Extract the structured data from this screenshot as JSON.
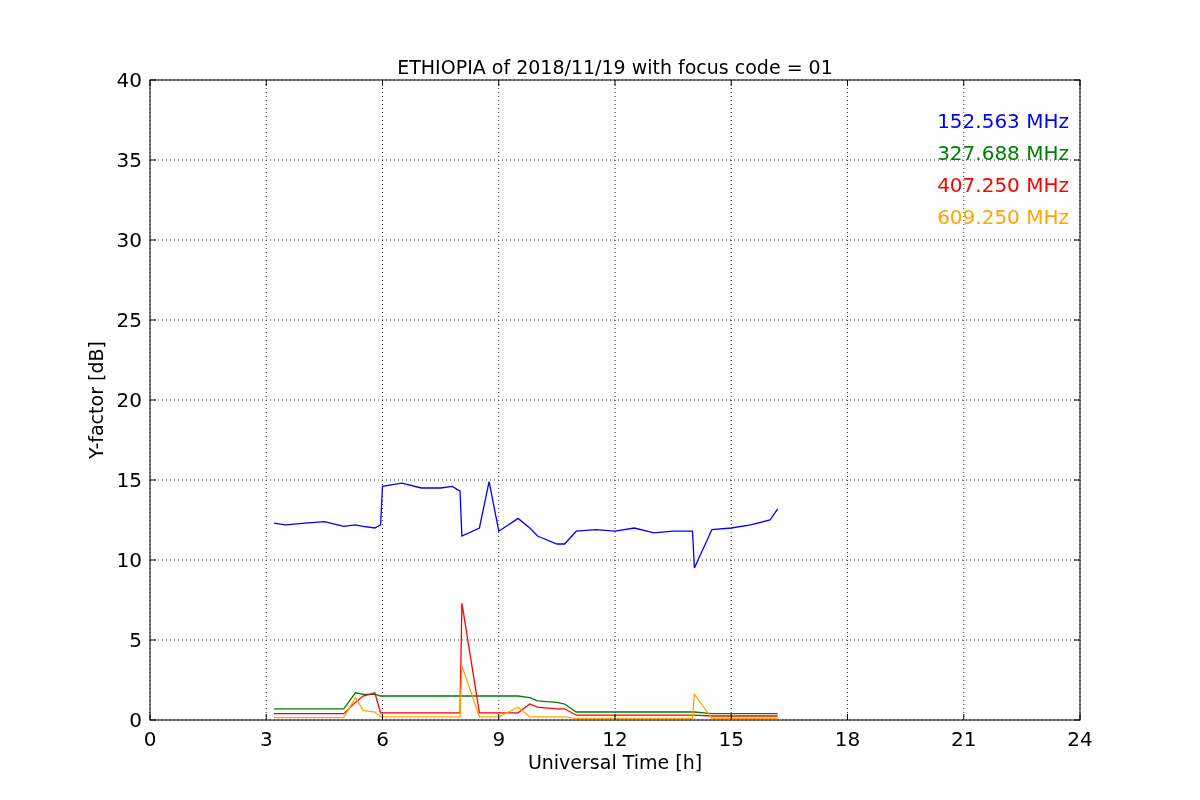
{
  "chart_data": {
    "type": "line",
    "title": "ETHIOPIA of 2018/11/19 with focus code = 01",
    "xlabel": "Universal Time [h]",
    "ylabel": "Y-factor [dB]",
    "grid": true,
    "x": [
      3.2,
      3.5,
      4,
      4.5,
      5,
      5.3,
      5.5,
      5.8,
      5.95,
      6,
      6.5,
      7,
      7.5,
      7.8,
      8,
      8.05,
      8.5,
      8.75,
      9,
      9.5,
      9.8,
      10,
      10.5,
      10.7,
      11,
      11.5,
      12,
      12.5,
      13,
      13.5,
      14,
      14.05,
      14.5,
      15,
      15.5,
      16,
      16.2
    ],
    "series": [
      {
        "name": "152.563 MHz",
        "color": "#0000ff",
        "values": [
          12.3,
          12.2,
          12.3,
          12.4,
          12.1,
          12.2,
          12.1,
          12.0,
          12.2,
          14.6,
          14.8,
          14.5,
          14.5,
          14.6,
          14.3,
          11.5,
          12.0,
          14.9,
          11.8,
          12.6,
          12.0,
          11.5,
          11.0,
          11.0,
          11.8,
          11.9,
          11.8,
          12.0,
          11.7,
          11.8,
          11.8,
          9.5,
          11.9,
          12.0,
          12.2,
          12.5,
          13.2
        ]
      },
      {
        "name": "327.688 MHz",
        "color": "#008000",
        "values": [
          0.7,
          0.7,
          0.7,
          0.7,
          0.7,
          1.7,
          1.6,
          1.6,
          1.5,
          1.5,
          1.5,
          1.5,
          1.5,
          1.5,
          1.5,
          1.5,
          1.5,
          1.5,
          1.5,
          1.5,
          1.4,
          1.2,
          1.1,
          1.0,
          0.5,
          0.5,
          0.5,
          0.5,
          0.5,
          0.5,
          0.5,
          0.5,
          0.4,
          0.4,
          0.4,
          0.4,
          0.4
        ]
      },
      {
        "name": "407.250 MHz",
        "color": "#ff0000",
        "values": [
          0.4,
          0.4,
          0.4,
          0.4,
          0.4,
          1.1,
          1.5,
          1.7,
          0.45,
          0.45,
          0.45,
          0.45,
          0.45,
          0.45,
          0.45,
          7.3,
          0.45,
          0.45,
          0.45,
          0.45,
          1.0,
          0.8,
          0.7,
          0.7,
          0.3,
          0.3,
          0.3,
          0.3,
          0.3,
          0.3,
          0.3,
          0.3,
          0.25,
          0.25,
          0.25,
          0.25,
          0.25
        ]
      },
      {
        "name": "609.250 MHz",
        "color": "#ffa500",
        "values": [
          0.15,
          0.15,
          0.15,
          0.15,
          0.15,
          1.4,
          0.6,
          0.5,
          0.2,
          0.2,
          0.2,
          0.2,
          0.2,
          0.2,
          0.2,
          3.4,
          0.2,
          0.2,
          0.2,
          0.8,
          0.2,
          0.2,
          0.2,
          0.2,
          0.1,
          0.1,
          0.1,
          0.1,
          0.1,
          0.1,
          0.1,
          1.6,
          0.1,
          0.1,
          0.1,
          0.1,
          0.1
        ]
      }
    ],
    "xlim": [
      0,
      24
    ],
    "ylim": [
      0,
      40
    ],
    "xticks": [
      0,
      3,
      6,
      9,
      12,
      15,
      18,
      21,
      24
    ],
    "yticks": [
      0,
      5,
      10,
      15,
      20,
      25,
      30,
      35,
      40
    ]
  }
}
